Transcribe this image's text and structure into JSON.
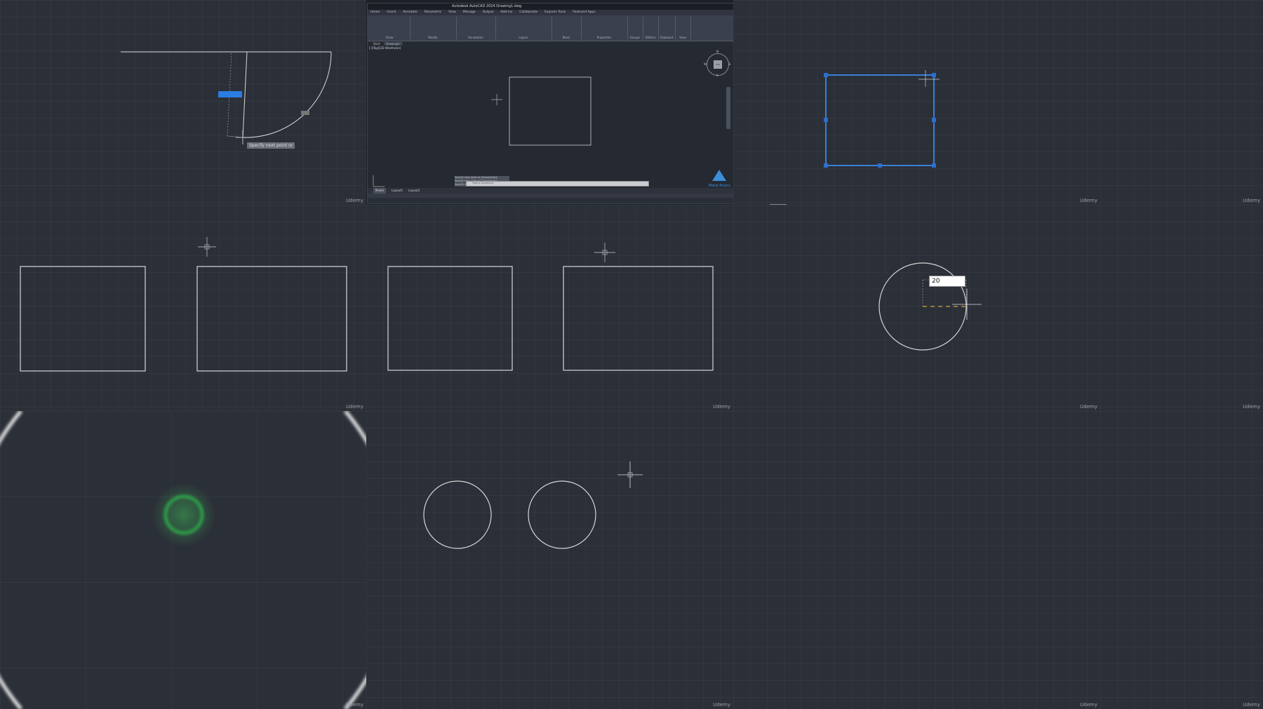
{
  "watermark": "Udemy",
  "panel1": {
    "dynamic_input": "",
    "angle_badge": "",
    "prompt": "Specify next point or"
  },
  "panel2": {
    "title": "Autodesk AutoCAD 2024  Drawing1.dwg",
    "ribbon_tabs": [
      "Home",
      "Insert",
      "Annotate",
      "Parametric",
      "View",
      "Manage",
      "Output",
      "Add-ins",
      "Collaborate",
      "Express Tools",
      "Featured Apps"
    ],
    "ribbon_groups": [
      "Draw",
      "Modify",
      "Annotation",
      "Layers",
      "Block",
      "Properties",
      "Groups",
      "Utilities",
      "Clipboard",
      "View"
    ],
    "doc_tabs": [
      "Start",
      "Drawing1*"
    ],
    "viewport_label": "[-][Top][2D Wireframe]",
    "command_history": [
      "Specify next point or [Close/Undo]:",
      "Specify next point or [Close/Undo]:",
      "Specify next point or [Close/Undo]: *Cancel*"
    ],
    "command_placeholder": "Type a command",
    "layout_tabs": [
      "Model",
      "Layout1",
      "Layout2"
    ],
    "brand": "Metal Brains",
    "compass": {
      "n": "N",
      "s": "S",
      "e": "E",
      "w": "W",
      "top": "TOP"
    }
  },
  "panel6": {
    "radius_input": "20"
  }
}
